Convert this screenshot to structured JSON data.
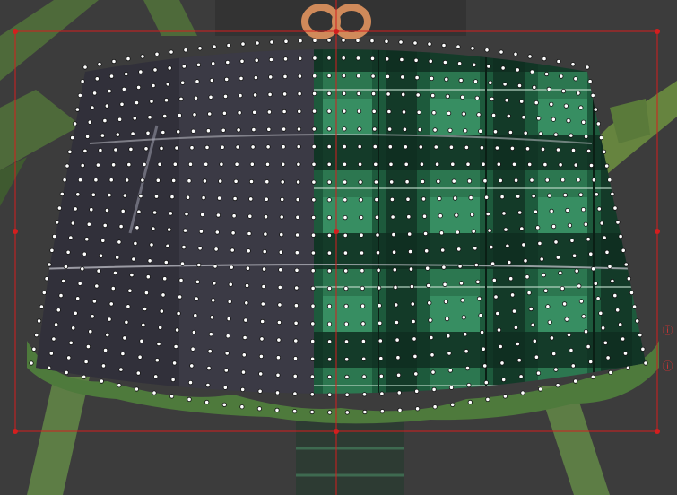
{
  "editor": {
    "canvas_label": "",
    "colors": {
      "background": "#3c3c3c",
      "skirt_dark": "#3b3a45",
      "skirt_dark_shade": "#2b2a33",
      "plaid_base": "#1d5a3c",
      "plaid_light": "#3fa070",
      "plaid_dark": "#0e2c1f",
      "ruffle": "#4e7a3c",
      "ribbon": "#566d3e",
      "ribbon_dark": "#2e3f22",
      "bow": "#d08a5a",
      "bounding_box": "#d41e1e",
      "mesh_points": "#ffffff",
      "mesh_outline": "#111111"
    },
    "mesh": {
      "columns": 36,
      "rows": 22,
      "edge_indicators": [
        "ⓘ",
        "ⓘ"
      ]
    },
    "handles": [
      "top-left",
      "top-center",
      "top-right",
      "middle-left",
      "center",
      "middle-right",
      "bottom-left",
      "bottom-center",
      "bottom-right"
    ]
  }
}
